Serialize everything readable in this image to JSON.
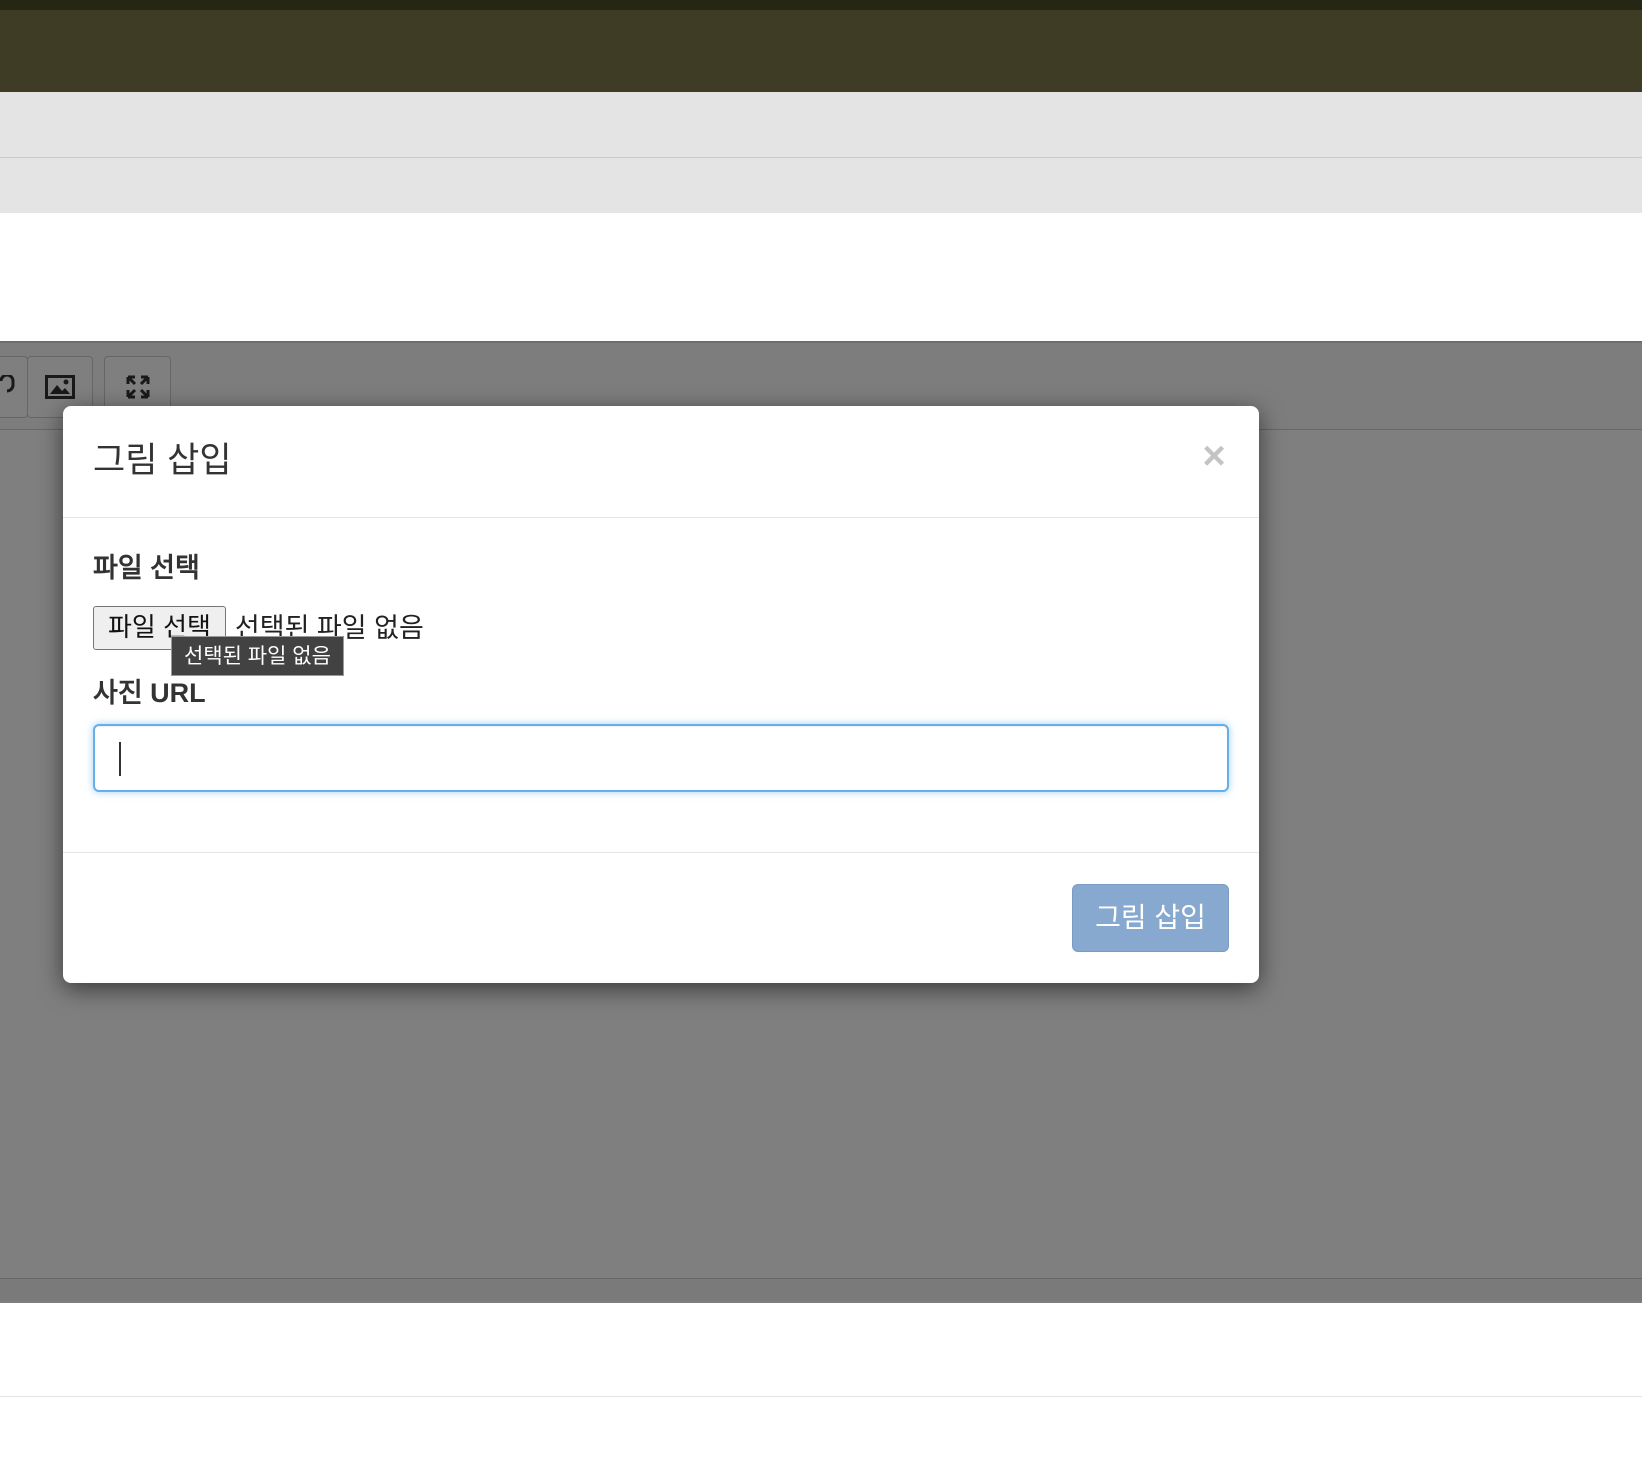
{
  "modal": {
    "title": "그림 삽입",
    "close_glyph": "×",
    "file_section": {
      "label": "파일 선택",
      "button_label": "파일 선택",
      "status_text": "선택된 파일 없음",
      "tooltip_text": "선택된 파일 없음"
    },
    "url_section": {
      "label": "사진 URL",
      "value": "",
      "placeholder": ""
    },
    "insert_button_label": "그림 삽입"
  },
  "toolbar": {
    "icons": [
      "link-icon",
      "image-icon",
      "fullscreen-icon"
    ]
  },
  "colors": {
    "top_bar": "#3e3c24",
    "top_strip": "#252614",
    "band": "#e4e4e4",
    "insert_button": "#88a9cf",
    "focus_border": "#66afe9",
    "tooltip_bg": "#424242"
  }
}
